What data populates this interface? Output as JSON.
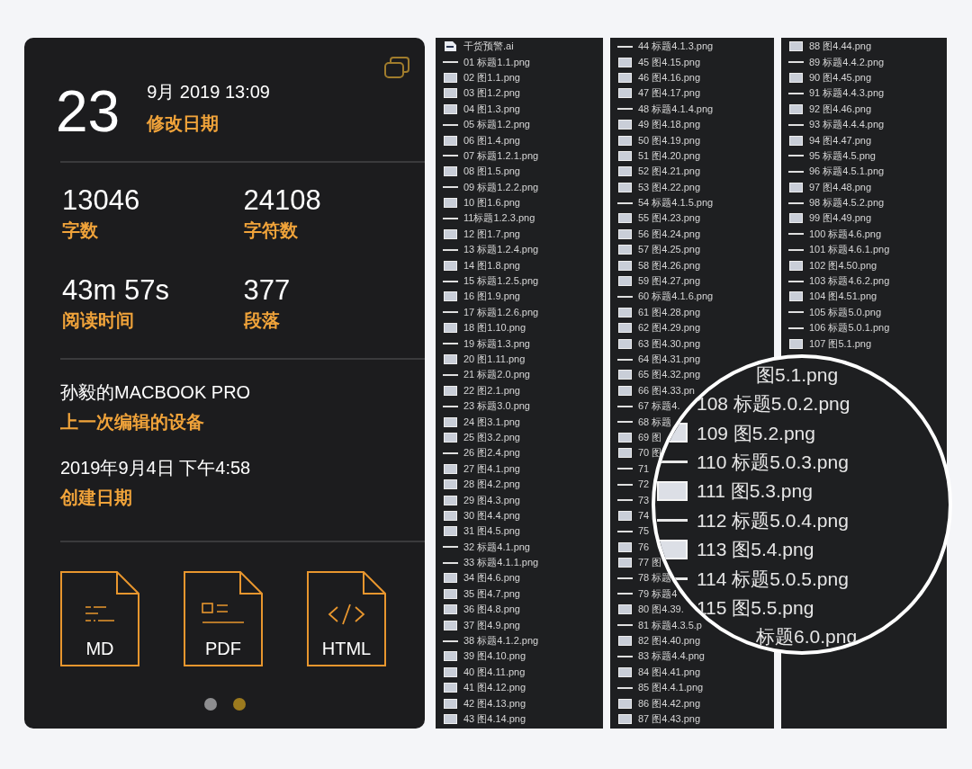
{
  "info_panel": {
    "day": "23",
    "datetime": "9月 2019 13:09",
    "datetime_label": "修改日期",
    "stats": [
      {
        "value": "13046",
        "label": "字数"
      },
      {
        "value": "24108",
        "label": "字符数"
      },
      {
        "value": "43m 57s",
        "label": "阅读时间"
      },
      {
        "value": "377",
        "label": "段落"
      }
    ],
    "details": [
      {
        "value": "孙毅的MACBOOK PRO",
        "label": "上一次编辑的设备"
      },
      {
        "value": "2019年9月4日 下午4:58",
        "label": "创建日期"
      }
    ],
    "exports": [
      {
        "kind": "md",
        "label": "MD"
      },
      {
        "kind": "pdf",
        "label": "PDF"
      },
      {
        "kind": "html",
        "label": "HTML"
      }
    ],
    "pages": [
      {
        "selected": false
      },
      {
        "selected": true
      }
    ]
  },
  "file_columns": [
    [
      {
        "kind": "file",
        "name": "干货预警.ai"
      },
      {
        "kind": "title",
        "name": "01 标题1.1.png"
      },
      {
        "kind": "image",
        "name": "02 图1.1.png"
      },
      {
        "kind": "image",
        "name": "03 图1.2.png"
      },
      {
        "kind": "image",
        "name": "04 图1.3.png"
      },
      {
        "kind": "title",
        "name": "05 标题1.2.png"
      },
      {
        "kind": "image",
        "name": "06 图1.4.png"
      },
      {
        "kind": "title",
        "name": "07 标题1.2.1.png"
      },
      {
        "kind": "image",
        "name": "08 图1.5.png"
      },
      {
        "kind": "title",
        "name": "09 标题1.2.2.png"
      },
      {
        "kind": "image",
        "name": "10 图1.6.png"
      },
      {
        "kind": "title",
        "name": "11标题1.2.3.png"
      },
      {
        "kind": "image",
        "name": "12 图1.7.png"
      },
      {
        "kind": "title",
        "name": "13 标题1.2.4.png"
      },
      {
        "kind": "image",
        "name": "14 图1.8.png"
      },
      {
        "kind": "title",
        "name": "15 标题1.2.5.png"
      },
      {
        "kind": "image",
        "name": "16 图1.9.png"
      },
      {
        "kind": "title",
        "name": "17 标题1.2.6.png"
      },
      {
        "kind": "image",
        "name": "18 图1.10.png"
      },
      {
        "kind": "title",
        "name": "19 标题1.3.png"
      },
      {
        "kind": "image",
        "name": "20 图1.11.png"
      },
      {
        "kind": "title",
        "name": "21 标题2.0.png"
      },
      {
        "kind": "image",
        "name": "22 图2.1.png"
      },
      {
        "kind": "title",
        "name": "23 标题3.0.png"
      },
      {
        "kind": "image",
        "name": "24 图3.1.png"
      },
      {
        "kind": "image",
        "name": "25 图3.2.png"
      },
      {
        "kind": "title",
        "name": "26 图2.4.png"
      },
      {
        "kind": "image",
        "name": "27 图4.1.png"
      },
      {
        "kind": "image",
        "name": "28 图4.2.png"
      },
      {
        "kind": "image",
        "name": "29 图4.3.png"
      },
      {
        "kind": "image",
        "name": "30 图4.4.png"
      },
      {
        "kind": "image",
        "name": "31 图4.5.png"
      },
      {
        "kind": "title",
        "name": "32 标题4.1.png"
      },
      {
        "kind": "title",
        "name": "33 标题4.1.1.png"
      },
      {
        "kind": "image",
        "name": "34 图4.6.png"
      },
      {
        "kind": "image",
        "name": "35 图4.7.png"
      },
      {
        "kind": "image",
        "name": "36 图4.8.png"
      },
      {
        "kind": "image",
        "name": "37 图4.9.png"
      },
      {
        "kind": "title",
        "name": "38 标题4.1.2.png"
      },
      {
        "kind": "image",
        "name": "39 图4.10.png"
      },
      {
        "kind": "image",
        "name": "40 图4.11.png"
      },
      {
        "kind": "image",
        "name": "41 图4.12.png"
      },
      {
        "kind": "image",
        "name": "42 图4.13.png"
      },
      {
        "kind": "image",
        "name": "43 图4.14.png"
      }
    ],
    [
      {
        "kind": "title",
        "name": "44 标题4.1.3.png"
      },
      {
        "kind": "image",
        "name": "45 图4.15.png"
      },
      {
        "kind": "image",
        "name": "46 图4.16.png"
      },
      {
        "kind": "image",
        "name": "47 图4.17.png"
      },
      {
        "kind": "title",
        "name": "48 标题4.1.4.png"
      },
      {
        "kind": "image",
        "name": "49 图4.18.png"
      },
      {
        "kind": "image",
        "name": "50 图4.19.png"
      },
      {
        "kind": "image",
        "name": "51 图4.20.png"
      },
      {
        "kind": "image",
        "name": "52 图4.21.png"
      },
      {
        "kind": "image",
        "name": "53 图4.22.png"
      },
      {
        "kind": "title",
        "name": "54 标题4.1.5.png"
      },
      {
        "kind": "image",
        "name": "55 图4.23.png"
      },
      {
        "kind": "image",
        "name": "56 图4.24.png"
      },
      {
        "kind": "image",
        "name": "57 图4.25.png"
      },
      {
        "kind": "image",
        "name": "58 图4.26.png"
      },
      {
        "kind": "image",
        "name": "59 图4.27.png"
      },
      {
        "kind": "title",
        "name": "60 标题4.1.6.png"
      },
      {
        "kind": "image",
        "name": "61 图4.28.png"
      },
      {
        "kind": "image",
        "name": "62 图4.29.png"
      },
      {
        "kind": "image",
        "name": "63 图4.30.png"
      },
      {
        "kind": "title",
        "name": "64 图4.31.png"
      },
      {
        "kind": "image",
        "name": "65 图4.32.png"
      },
      {
        "kind": "image",
        "name": "66 图4.33.pn"
      },
      {
        "kind": "title",
        "name": "67 标题4."
      },
      {
        "kind": "title",
        "name": "68 标题"
      },
      {
        "kind": "image",
        "name": "69 图"
      },
      {
        "kind": "image",
        "name": "70 图"
      },
      {
        "kind": "title",
        "name": "71"
      },
      {
        "kind": "title",
        "name": "72"
      },
      {
        "kind": "title",
        "name": "73"
      },
      {
        "kind": "image",
        "name": "74"
      },
      {
        "kind": "title",
        "name": "75"
      },
      {
        "kind": "image",
        "name": "76"
      },
      {
        "kind": "image",
        "name": "77 图"
      },
      {
        "kind": "title",
        "name": "78 标题"
      },
      {
        "kind": "title",
        "name": "79 标题4"
      },
      {
        "kind": "image",
        "name": "80 图4.39."
      },
      {
        "kind": "title",
        "name": "81 标题4.3.5.p"
      },
      {
        "kind": "image",
        "name": "82 图4.40.png"
      },
      {
        "kind": "title",
        "name": "83 标题4.4.png"
      },
      {
        "kind": "image",
        "name": "84 图4.41.png"
      },
      {
        "kind": "title",
        "name": "85 图4.4.1.png"
      },
      {
        "kind": "image",
        "name": "86 图4.42.png"
      },
      {
        "kind": "image",
        "name": "87 图4.43.png"
      }
    ],
    [
      {
        "kind": "image",
        "name": "88 图4.44.png"
      },
      {
        "kind": "title",
        "name": "89 标题4.4.2.png"
      },
      {
        "kind": "image",
        "name": "90 图4.45.png"
      },
      {
        "kind": "title",
        "name": "91 标题4.4.3.png"
      },
      {
        "kind": "image",
        "name": "92 图4.46.png"
      },
      {
        "kind": "title",
        "name": "93 标题4.4.4.png"
      },
      {
        "kind": "image",
        "name": "94 图4.47.png"
      },
      {
        "kind": "title",
        "name": "95 标题4.5.png"
      },
      {
        "kind": "title",
        "name": "96 标题4.5.1.png"
      },
      {
        "kind": "image",
        "name": "97 图4.48.png"
      },
      {
        "kind": "title",
        "name": "98 标题4.5.2.png"
      },
      {
        "kind": "image",
        "name": "99 图4.49.png"
      },
      {
        "kind": "title",
        "name": "100 标题4.6.png"
      },
      {
        "kind": "title",
        "name": "101 标题4.6.1.png"
      },
      {
        "kind": "image",
        "name": "102 图4.50.png"
      },
      {
        "kind": "title",
        "name": "103 标题4.6.2.png"
      },
      {
        "kind": "image",
        "name": "104 图4.51.png"
      },
      {
        "kind": "title",
        "name": "105 标题5.0.png"
      },
      {
        "kind": "title",
        "name": "106 标题5.0.1.png"
      },
      {
        "kind": "image",
        "name": "107 图5.1.png"
      }
    ]
  ],
  "magnifier": [
    {
      "kind": "cut",
      "name": "图5.1.png"
    },
    {
      "kind": "bare",
      "name": "108 标题5.0.2.png"
    },
    {
      "kind": "image",
      "name": "109 图5.2.png"
    },
    {
      "kind": "title",
      "name": "110 标题5.0.3.png"
    },
    {
      "kind": "image",
      "name": "111 图5.3.png"
    },
    {
      "kind": "title",
      "name": "112 标题5.0.4.png"
    },
    {
      "kind": "image",
      "name": "113 图5.4.png"
    },
    {
      "kind": "title",
      "name": "114 标题5.0.5.png"
    },
    {
      "kind": "bare",
      "name": "115 图5.5.png"
    },
    {
      "kind": "cut",
      "name": "标题6.0.png"
    }
  ]
}
